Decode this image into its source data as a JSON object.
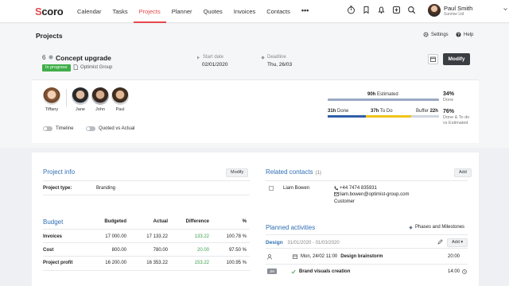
{
  "app": {
    "logo": "Scoro"
  },
  "nav": {
    "items": [
      {
        "label": "Calendar",
        "active": false
      },
      {
        "label": "Tasks",
        "active": false
      },
      {
        "label": "Projects",
        "active": true
      },
      {
        "label": "Planner",
        "active": false
      },
      {
        "label": "Quotes",
        "active": false
      },
      {
        "label": "Invoices",
        "active": false
      },
      {
        "label": "Contacts",
        "active": false
      }
    ],
    "more": "•••",
    "icons": [
      "timer-icon",
      "bookmark-icon",
      "bell-icon",
      "add-icon",
      "search-icon"
    ]
  },
  "user": {
    "name": "Paul Smith",
    "company": "Sunrise Ltd"
  },
  "page": {
    "title": "Projects",
    "settings": "Settings",
    "help": "Help"
  },
  "project": {
    "number": "6",
    "name": "Concept upgrade",
    "status": "In progress",
    "client": "Optimist Group",
    "start_label": "Start date",
    "start_date": "02/01/2020",
    "deadline_label": "Deadline",
    "deadline": "Thu, 26/03",
    "modify": "Modify"
  },
  "team": {
    "members": [
      {
        "name": "Tiffany"
      },
      {
        "name": "Jane"
      },
      {
        "name": "John"
      },
      {
        "name": "Paul"
      }
    ],
    "toggles": {
      "timeline": "Timeline",
      "quoted": "Quoted vs Actual"
    }
  },
  "progress": {
    "estimated_value": "90h",
    "estimated_label": "Estimated",
    "done_value": "31h",
    "done_label": "Done",
    "todo_value": "37h",
    "todo_label": "To Do",
    "buffer_label": "Buffer",
    "buffer_value": "22h",
    "done_pct": "34%",
    "done_pct_label": "Done",
    "todo_pct": "76%",
    "todo_pct_label_1": "Done & To do",
    "todo_pct_label_2": "vs Estimated",
    "done_fraction": 0.34,
    "todo_fraction": 0.41,
    "colors": {
      "done": "#2f5fa8",
      "todo": "#f0c419",
      "buffer": "#cfd6e0",
      "estimated": "#9aa9c4"
    }
  },
  "info": {
    "title": "Project info",
    "modify": "Modify",
    "type_label": "Project type:",
    "type_value": "Branding"
  },
  "budget": {
    "title": "Budget",
    "headers": [
      "Budgeted",
      "Actual",
      "Difference",
      "%"
    ],
    "rows": [
      {
        "label": "Invoices",
        "budgeted": "17 000.00",
        "actual": "17 133.22",
        "difference": "133.22",
        "pct": "100.78 %"
      },
      {
        "label": "Cost",
        "budgeted": "800.00",
        "actual": "780.00",
        "difference": "20.00",
        "pct": "97.50 %"
      },
      {
        "label": "Project profit",
        "budgeted": "16 200.00",
        "actual": "16 353.22",
        "difference": "153.22",
        "pct": "100.95 %"
      }
    ]
  },
  "contacts": {
    "title": "Related contacts",
    "count": "(1)",
    "add": "Add",
    "name": "Liam Bowen",
    "phone": "+44 7474 835931",
    "email": "liam.bowen@optimist-group.com",
    "role": "Customer"
  },
  "activities": {
    "title": "Planned activities",
    "phases_link": "Phases and Milestones",
    "phase_name": "Design",
    "phase_dates": "31/01/2020 - 01/03/2020",
    "add": "Add",
    "rows": [
      {
        "date": "Mon, 24/02 11:00",
        "name": "Design brainstorm",
        "time": "20:00"
      },
      {
        "tag": "JM",
        "name": "Brand visuals creation",
        "time": "14:00"
      }
    ]
  }
}
